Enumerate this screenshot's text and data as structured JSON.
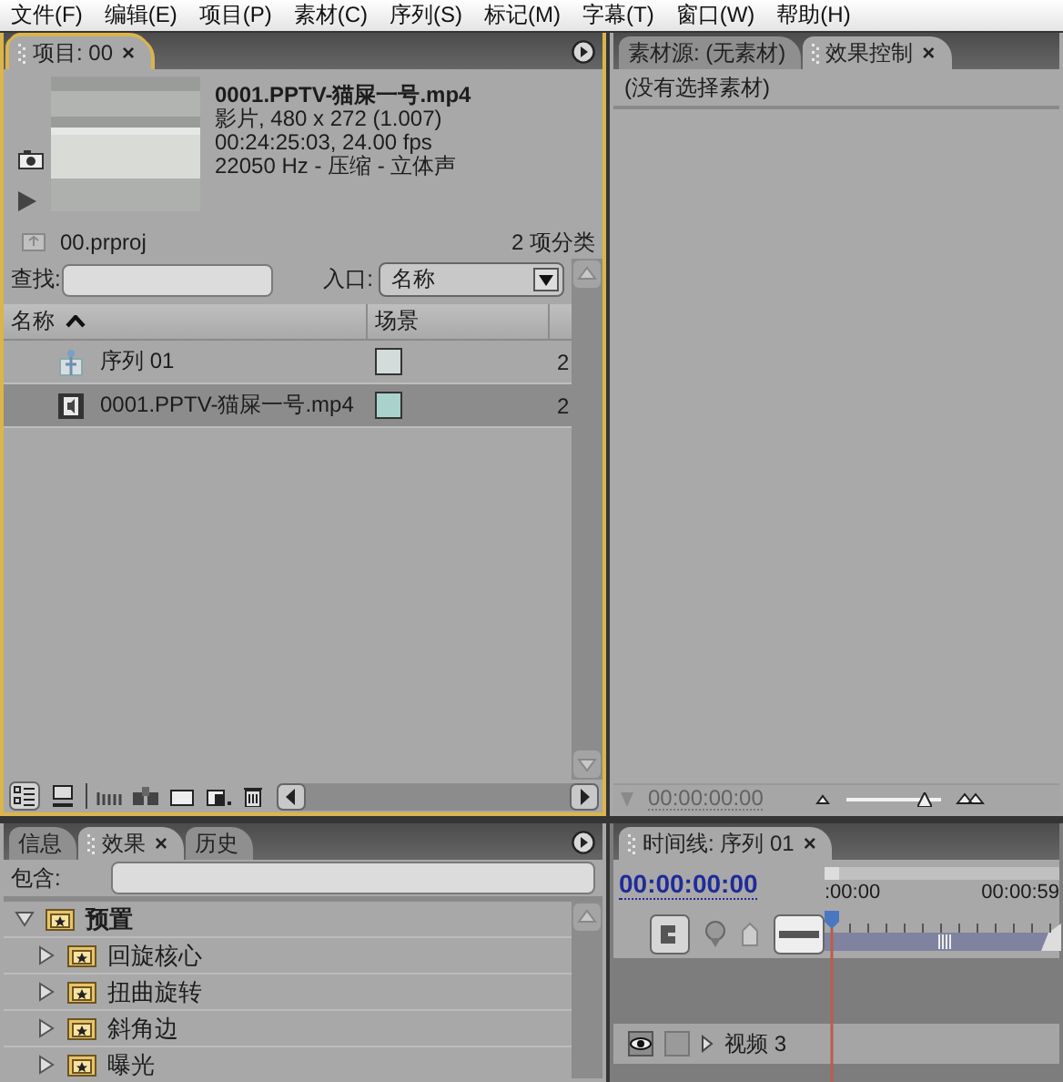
{
  "menu_bar": [
    {
      "label": "文件(F)"
    },
    {
      "label": "编辑(E)"
    },
    {
      "label": "项目(P)"
    },
    {
      "label": "素材(C)"
    },
    {
      "label": "序列(S)"
    },
    {
      "label": "标记(M)"
    },
    {
      "label": "字幕(T)"
    },
    {
      "label": "窗口(W)"
    },
    {
      "label": "帮助(H)"
    }
  ],
  "project_panel": {
    "focused": true,
    "tabs": [
      {
        "label": "项目: 00",
        "selected": true,
        "close": "×"
      }
    ],
    "clip_info": {
      "name": "0001.PPTV-猫屎一号.mp4",
      "lines": [
        "影片, 480 x 272 (1.007)",
        "00:24:25:03, 24.00 fps",
        "22050 Hz - 压缩 - 立体声"
      ]
    },
    "project_file": "00.prproj",
    "item_count": "2 项分类",
    "search": {
      "label": "查找:"
    },
    "entry": {
      "label": "入口:",
      "value": "名称"
    },
    "table": {
      "columns": [
        {
          "label": "名称",
          "sorted": true
        },
        {
          "label": "场景",
          "sorted": false
        }
      ],
      "rows": [
        {
          "kind": "sequence",
          "name": "序列 01",
          "color": "#d3dbdb",
          "column_3": "2",
          "selected": false
        },
        {
          "kind": "clip",
          "name": "0001.PPTV-猫屎一号.mp4",
          "color": "#a9d2cb",
          "column_3": "2",
          "selected": true
        }
      ]
    },
    "view_buttons": [
      {
        "kind": "list",
        "selected": true
      },
      {
        "kind": "icon",
        "selected": false
      }
    ]
  },
  "source_panel": {
    "focused": false,
    "tabs": [
      {
        "label": "素材源: (无素材)",
        "selected": false
      },
      {
        "label": "效果控制",
        "selected": true,
        "close": "×"
      }
    ],
    "message": "(没有选择素材)",
    "timecode": "00:00:00:00",
    "zoom": {
      "level": 0.82
    }
  },
  "effects_panel": {
    "focused": false,
    "tabs": [
      {
        "label": "信息",
        "selected": false
      },
      {
        "label": "效果",
        "selected": true,
        "close": "×"
      },
      {
        "label": "历史",
        "selected": false
      }
    ],
    "filter": {
      "label": "包含:"
    },
    "tree": [
      {
        "label": "预置",
        "expanded": true,
        "children": [
          {
            "label": "回旋核心",
            "expanded": false
          },
          {
            "label": "扭曲旋转",
            "expanded": false
          },
          {
            "label": "斜角边",
            "expanded": false
          },
          {
            "label": "曝光",
            "expanded": false
          }
        ]
      }
    ]
  },
  "timeline_panel": {
    "focused": false,
    "tabs": [
      {
        "label": "时间线: 序列 01",
        "selected": true,
        "close": "×"
      }
    ],
    "timecode": "00:00:00:00",
    "ruler_labels": [
      ":00:00",
      "00:00:59"
    ],
    "tracks": [
      {
        "name": "视频 3",
        "visible": true
      }
    ]
  }
}
